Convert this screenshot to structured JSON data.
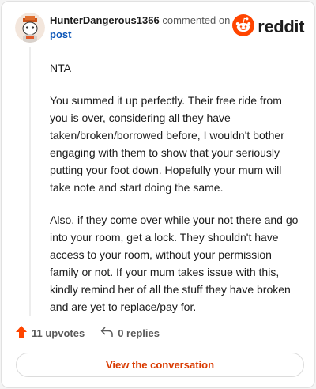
{
  "comment": {
    "author": "HunterDangerous1366",
    "action": "commented on",
    "target": "post",
    "paragraphs": [
      "NTA",
      "You summed it up perfectly. Their free ride from you is over, considering all they have taken/broken/borrowed before, I wouldn't bother engaging with them to show that your seriously putting your foot down. Hopefully your mum will take note and start doing the same.",
      "Also, if they come over while your not there and go into your room, get a lock. They shouldn't have access to your room, without your permission family or not. If your mum takes issue with this, kindly remind her of all the stuff they have broken and are yet to replace/pay for."
    ],
    "upvotes": "11 upvotes",
    "replies": "0 replies"
  },
  "brand": {
    "name": "reddit",
    "icon": "reddit-snoo-icon",
    "color": "#ff4500"
  },
  "footer": {
    "cta_label": "View the conversation"
  },
  "colors": {
    "accent": "#ff4500",
    "link": "#0a55b8",
    "cta_text": "#d93a00"
  }
}
